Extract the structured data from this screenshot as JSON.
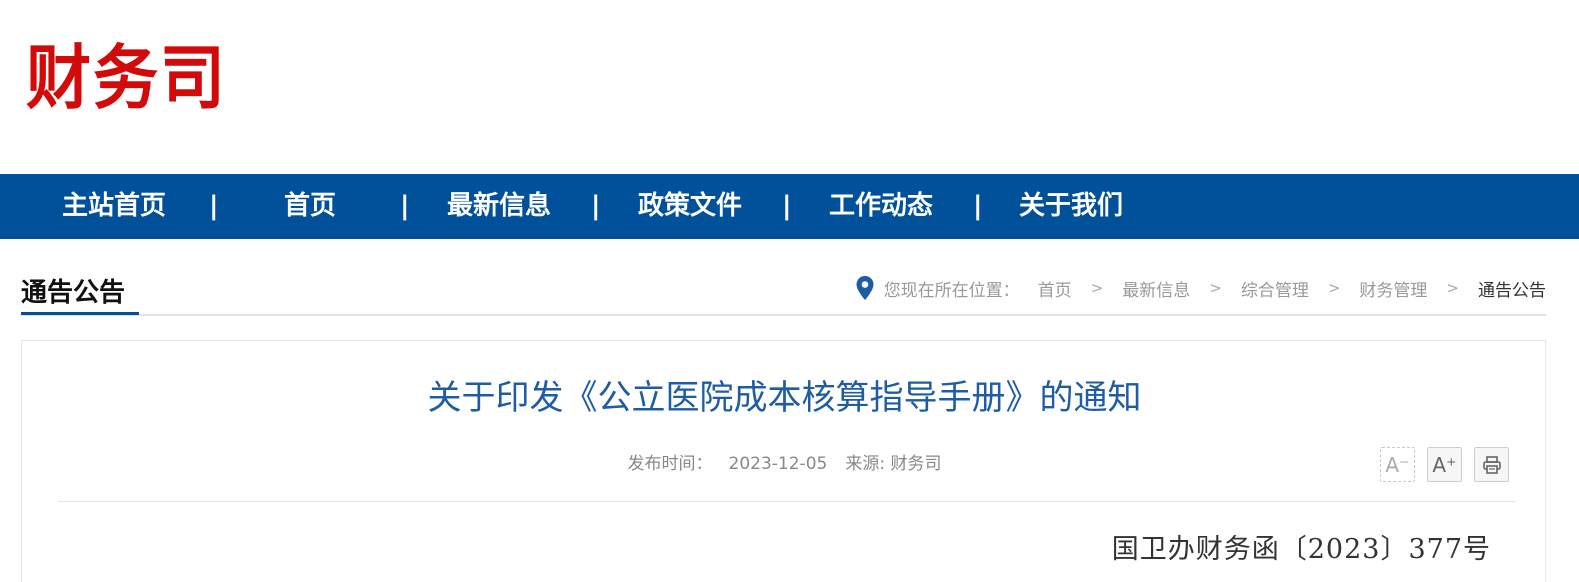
{
  "header": {
    "logo_text": "财务司"
  },
  "nav": {
    "items": [
      {
        "label": "主站首页"
      },
      {
        "label": "首页"
      },
      {
        "label": "最新信息"
      },
      {
        "label": "政策文件"
      },
      {
        "label": "工作动态"
      },
      {
        "label": "关于我们"
      }
    ],
    "separator": "|"
  },
  "section": {
    "title": "通告公告"
  },
  "breadcrumb": {
    "label": "您现在所在位置：",
    "items": [
      "首页",
      "最新信息",
      "综合管理",
      "财务管理",
      "通告公告"
    ],
    "separator": ">"
  },
  "article": {
    "title": "关于印发《公立医院成本核算指导手册》的通知",
    "publish_label": "发布时间：",
    "publish_date": "2023-12-05",
    "source_label": "来源:",
    "source": "财务司",
    "doc_number": "国卫办财务函〔2023〕377号"
  },
  "tools": {
    "font_decrease_icon": "A⁻",
    "font_increase_icon": "A⁺",
    "print_icon": "printer-icon"
  },
  "colors": {
    "brand_red": "#d20a0a",
    "nav_blue": "#00519a",
    "title_blue": "#1e5ca3"
  }
}
